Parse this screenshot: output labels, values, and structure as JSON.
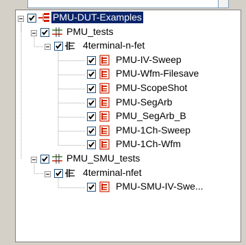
{
  "tree": {
    "nodes": [
      {
        "label": "PMU-DUT-Examples",
        "icon": "project-icon",
        "checked": true,
        "expanded": true,
        "selected": true,
        "level": 0
      },
      {
        "label": "PMU_tests",
        "icon": "subsite-icon",
        "checked": true,
        "expanded": true,
        "selected": false,
        "level": 1
      },
      {
        "label": "4terminal-n-fet",
        "icon": "device-icon",
        "checked": true,
        "expanded": true,
        "selected": false,
        "level": 2
      },
      {
        "label": "PMU-IV-Sweep",
        "icon": "test-icon",
        "checked": true,
        "selected": false,
        "level": 3
      },
      {
        "label": "PMU-Wfm-Filesave",
        "icon": "test-icon",
        "checked": true,
        "selected": false,
        "level": 3
      },
      {
        "label": "PMU-ScopeShot",
        "icon": "test-icon",
        "checked": true,
        "selected": false,
        "level": 3
      },
      {
        "label": "PMU-SegArb",
        "icon": "test-icon",
        "checked": true,
        "selected": false,
        "level": 3
      },
      {
        "label": "PMU_SegArb_B",
        "icon": "test-icon",
        "checked": true,
        "selected": false,
        "level": 3
      },
      {
        "label": "PMU-1Ch-Sweep",
        "icon": "test-icon",
        "checked": true,
        "selected": false,
        "level": 3
      },
      {
        "label": "PMU-1Ch-Wfm",
        "icon": "test-icon",
        "checked": true,
        "selected": false,
        "level": 3
      },
      {
        "label": "PMU_SMU_tests",
        "icon": "subsite-icon",
        "checked": true,
        "expanded": true,
        "selected": false,
        "level": 1
      },
      {
        "label": "4terminal-nfet",
        "icon": "device-icon",
        "checked": true,
        "expanded": true,
        "selected": false,
        "level": 2
      },
      {
        "label": "PMU-SMU-IV-Swe...",
        "icon": "test-icon",
        "checked": true,
        "selected": false,
        "level": 3
      }
    ]
  },
  "colors": {
    "selection": "#0a246a",
    "checkmark": "#000000",
    "test_icon": "#cc2200"
  }
}
